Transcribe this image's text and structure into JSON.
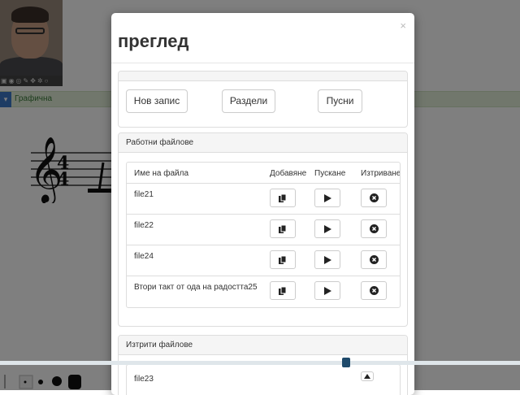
{
  "background": {
    "graph_label": "Графична"
  },
  "modal": {
    "title": "преглед",
    "close_glyph": "×",
    "top_buttons": {
      "new_record": "Нов запис",
      "sections": "Раздели",
      "play": "Пусни"
    },
    "work_files": {
      "heading": "Работни файлове",
      "columns": [
        "Име на файла",
        "Добавяне",
        "Пускане",
        "Изтриване"
      ],
      "rows": [
        {
          "name": "file21"
        },
        {
          "name": "file22"
        },
        {
          "name": "file24"
        },
        {
          "name": "Втори такт от ода на радостта25"
        }
      ]
    },
    "deleted_files": {
      "heading": "Изтрити файлове",
      "rows": [
        {
          "name": "file23"
        }
      ]
    }
  },
  "icons": {
    "add": "copy-icon",
    "play": "play-icon",
    "delete": "delete-icon",
    "restore": "caret-up-icon",
    "close": "close-icon"
  },
  "colors": {
    "graph_bar": "#e3efd8",
    "graph_text": "#3b7b3b",
    "slider_handle": "#1e4a6b"
  }
}
